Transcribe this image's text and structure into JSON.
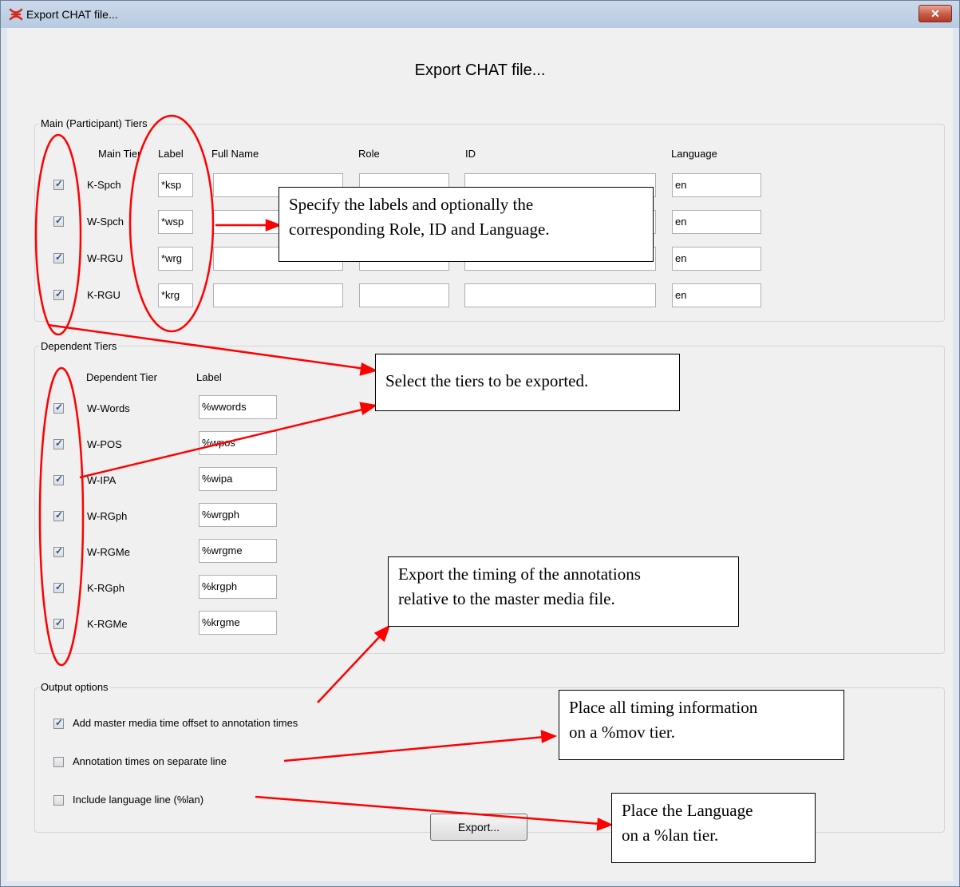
{
  "window": {
    "title": "Export CHAT file...",
    "close_label": "✕"
  },
  "dialog": {
    "heading": "Export CHAT file..."
  },
  "main_tiers": {
    "group_title": "Main (Participant) Tiers",
    "headers": {
      "main_tier": "Main Tier",
      "label": "Label",
      "full_name": "Full Name",
      "role": "Role",
      "id": "ID",
      "language": "Language"
    },
    "rows": [
      {
        "checked": true,
        "tier": "K-Spch",
        "label": "*ksp",
        "full_name": "",
        "role": "",
        "id": "",
        "language": "en"
      },
      {
        "checked": true,
        "tier": "W-Spch",
        "label": "*wsp",
        "full_name": "",
        "role": "",
        "id": "",
        "language": "en"
      },
      {
        "checked": true,
        "tier": "W-RGU",
        "label": "*wrg",
        "full_name": "",
        "role": "",
        "id": "",
        "language": "en"
      },
      {
        "checked": true,
        "tier": "K-RGU",
        "label": "*krg",
        "full_name": "",
        "role": "",
        "id": "",
        "language": "en"
      }
    ]
  },
  "dependent_tiers": {
    "group_title": "Dependent Tiers",
    "headers": {
      "dependent_tier": "Dependent Tier",
      "label": "Label"
    },
    "rows": [
      {
        "checked": true,
        "tier": "W-Words",
        "label": "%wwords"
      },
      {
        "checked": true,
        "tier": "W-POS",
        "label": "%wpos"
      },
      {
        "checked": true,
        "tier": "W-IPA",
        "label": "%wipa"
      },
      {
        "checked": true,
        "tier": "W-RGph",
        "label": "%wrgph"
      },
      {
        "checked": true,
        "tier": "W-RGMe",
        "label": "%wrgme"
      },
      {
        "checked": true,
        "tier": "K-RGph",
        "label": "%krgph"
      },
      {
        "checked": true,
        "tier": "K-RGMe",
        "label": "%krgme"
      }
    ]
  },
  "output_options": {
    "group_title": "Output options",
    "options": [
      {
        "checked": true,
        "label": "Add master media time offset to annotation times"
      },
      {
        "checked": false,
        "label": "Annotation times on separate line"
      },
      {
        "checked": false,
        "label": "Include language line (%lan)"
      }
    ]
  },
  "export_button": "Export...",
  "callouts": {
    "labels": [
      "Specify the labels and optionally the",
      "corresponding Role, ID and Language."
    ],
    "select": [
      "Select the tiers to be exported."
    ],
    "timing": [
      "Export the timing of the annotations",
      "relative to the master media file."
    ],
    "mov": [
      "Place all timing information",
      "on a %mov tier."
    ],
    "lan": [
      "Place the Language",
      "on a %lan tier."
    ]
  },
  "colors": {
    "annotation": "#ff0000",
    "checkmark": "#2b4f95",
    "close_button": "#c75a45"
  }
}
